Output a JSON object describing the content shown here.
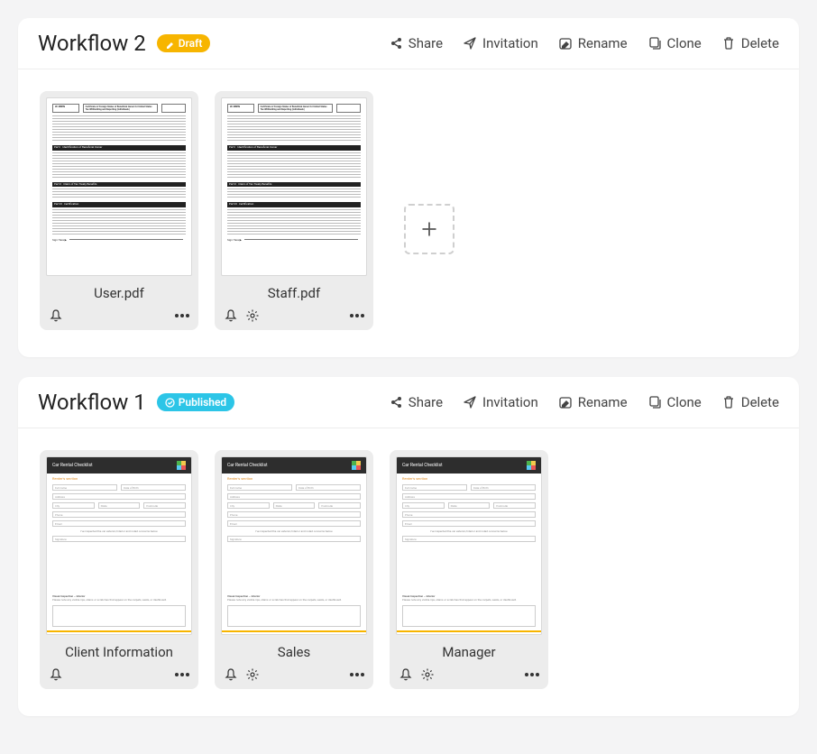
{
  "actions": {
    "share": "Share",
    "invitation": "Invitation",
    "rename": "Rename",
    "clone": "Clone",
    "delete": "Delete"
  },
  "workflows": [
    {
      "title": "Workflow 2",
      "status_label": "Draft",
      "status_kind": "draft",
      "docs": [
        {
          "name": "User.pdf",
          "thumb": "form",
          "has_gear": false
        },
        {
          "name": "Staff.pdf",
          "thumb": "form",
          "has_gear": true
        }
      ],
      "show_add": true
    },
    {
      "title": "Workflow 1",
      "status_label": "Published",
      "status_kind": "published",
      "docs": [
        {
          "name": "Client Information",
          "thumb": "checklist",
          "has_gear": false
        },
        {
          "name": "Sales",
          "thumb": "checklist",
          "has_gear": true
        },
        {
          "name": "Manager",
          "thumb": "checklist",
          "has_gear": true
        }
      ],
      "show_add": false
    }
  ],
  "thumb_text": {
    "checklist_title": "Car Rental Checklist",
    "checklist_section": "Renter's section",
    "f_fullname": "Full name",
    "f_dob": "Date of Birth",
    "f_address": "Address",
    "f_city": "City",
    "f_state": "State",
    "f_postcode": "Postcode",
    "f_phone": "Phone",
    "f_email": "Email",
    "f_signature": "Signature",
    "inspected": "I've inspected the car exterior/interior and noted concerns below",
    "visual_label": "Visual Inspection – Interior",
    "visual_sub": "Please note any visible rips, stains or scratches that appear on the carpets, seats, or dashboard."
  }
}
